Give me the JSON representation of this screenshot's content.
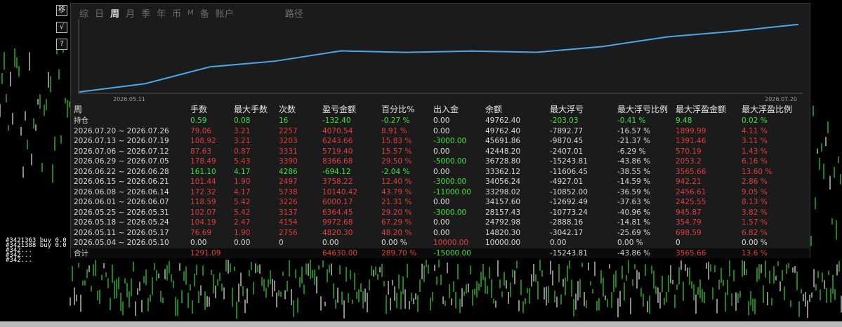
{
  "tabs": [
    "综",
    "日",
    "周",
    "月",
    "季",
    "年",
    "币",
    "M",
    "备",
    "账户",
    "路径"
  ],
  "active_tab": 2,
  "side_buttons": [
    "移",
    "√",
    "?"
  ],
  "chart": {
    "start_label": "2026.05.11",
    "end_label": "2026.07.20",
    "line_color": "#4aa8e8"
  },
  "columns": [
    "周",
    "手数",
    "最大手数",
    "次数",
    "盈亏金额",
    "百分比%",
    "出入金",
    "余额",
    "最大浮亏",
    "最大浮亏比例",
    "最大浮盈金额",
    "最大浮盈比例"
  ],
  "position_row": {
    "label": "持仓",
    "lots": "0.59",
    "max_lots": "0.08",
    "count": "16",
    "pnl": "-132.40",
    "pct": "-0.27 %",
    "flow": "0.00",
    "balance": "49762.40",
    "max_dd": "-203.03",
    "max_dd_pct": "-0.41 %",
    "max_fp": "9.48",
    "max_fp_pct": "0.02 %"
  },
  "rows": [
    {
      "week": "2026.07.20 ~ 2026.07.26",
      "lots": "79.06",
      "max_lots": "3.21",
      "count": "2257",
      "pnl": "4070.54",
      "pct": "8.91 %",
      "flow": "0.00",
      "balance": "49762.40",
      "max_dd": "-7892.77",
      "max_dd_pct": "-16.57 %",
      "max_fp": "1899.99",
      "max_fp_pct": "4.11 %"
    },
    {
      "week": "2026.07.13 ~ 2026.07.19",
      "lots": "108.92",
      "max_lots": "3.21",
      "count": "3203",
      "pnl": "6243.66",
      "pct": "15.83 %",
      "flow": "-3000.00",
      "balance": "45691.86",
      "max_dd": "-9870.45",
      "max_dd_pct": "-21.37 %",
      "max_fp": "1391.46",
      "max_fp_pct": "3.11 %"
    },
    {
      "week": "2026.07.06 ~ 2026.07.12",
      "lots": "87.63",
      "max_lots": "0.87",
      "count": "3331",
      "pnl": "5719.40",
      "pct": "15.57 %",
      "flow": "0.00",
      "balance": "42448.20",
      "max_dd": "-2407.01",
      "max_dd_pct": "-6.29 %",
      "max_fp": "570.19",
      "max_fp_pct": "1.43 %"
    },
    {
      "week": "2026.06.29 ~ 2026.07.05",
      "lots": "178.49",
      "max_lots": "5.43",
      "count": "3390",
      "pnl": "8366.68",
      "pct": "29.50 %",
      "flow": "-5000.00",
      "balance": "36728.80",
      "max_dd": "-15243.81",
      "max_dd_pct": "-43.86 %",
      "max_fp": "2053.2",
      "max_fp_pct": "6.16 %"
    },
    {
      "week": "2026.06.22 ~ 2026.06.28",
      "lots": "161.10",
      "max_lots": "4.17",
      "count": "4286",
      "pnl": "-694.12",
      "pct": "-2.04 %",
      "flow": "0.00",
      "balance": "33362.12",
      "max_dd": "-11606.45",
      "max_dd_pct": "-38.55 %",
      "max_fp": "3565.66",
      "max_fp_pct": "13.60 %",
      "loss": true
    },
    {
      "week": "2026.06.15 ~ 2026.06.21",
      "lots": "101.44",
      "max_lots": "1.90",
      "count": "2497",
      "pnl": "3758.22",
      "pct": "12.40 %",
      "flow": "-3000.00",
      "balance": "34056.24",
      "max_dd": "-4927.01",
      "max_dd_pct": "-14.59 %",
      "max_fp": "942.21",
      "max_fp_pct": "2.86 %"
    },
    {
      "week": "2026.06.08 ~ 2026.06.14",
      "lots": "172.32",
      "max_lots": "4.17",
      "count": "5738",
      "pnl": "10140.42",
      "pct": "43.79 %",
      "flow": "-11000.00",
      "balance": "33298.02",
      "max_dd": "-10852.00",
      "max_dd_pct": "-36.59 %",
      "max_fp": "2456.61",
      "max_fp_pct": "9.05 %"
    },
    {
      "week": "2026.06.01 ~ 2026.06.07",
      "lots": "118.59",
      "max_lots": "5.42",
      "count": "3226",
      "pnl": "6000.17",
      "pct": "21.31 %",
      "flow": "0.00",
      "balance": "34157.60",
      "max_dd": "-12692.49",
      "max_dd_pct": "-37.63 %",
      "max_fp": "2425.55",
      "max_fp_pct": "8.13 %"
    },
    {
      "week": "2026.05.25 ~ 2026.05.31",
      "lots": "102.07",
      "max_lots": "5.42",
      "count": "3137",
      "pnl": "6364.45",
      "pct": "29.20 %",
      "flow": "-3000.00",
      "balance": "28157.43",
      "max_dd": "-10773.24",
      "max_dd_pct": "-40.96 %",
      "max_fp": "945.87",
      "max_fp_pct": "3.82 %"
    },
    {
      "week": "2026.05.18 ~ 2026.05.24",
      "lots": "104.19",
      "max_lots": "2.47",
      "count": "4154",
      "pnl": "9972.68",
      "pct": "67.29 %",
      "flow": "0.00",
      "balance": "24792.98",
      "max_dd": "-2888.16",
      "max_dd_pct": "-14.81 %",
      "max_fp": "354.79",
      "max_fp_pct": "1.57 %"
    },
    {
      "week": "2026.05.11 ~ 2026.05.17",
      "lots": "76.69",
      "max_lots": "1.90",
      "count": "2756",
      "pnl": "4820.30",
      "pct": "48.20 %",
      "flow": "0.00",
      "balance": "14820.30",
      "max_dd": "-3042.17",
      "max_dd_pct": "-25.69 %",
      "max_fp": "698.59",
      "max_fp_pct": "6.82 %"
    },
    {
      "week": "2026.05.04 ~ 2026.05.10",
      "lots": "0.00",
      "max_lots": "0.00",
      "count": "0",
      "pnl": "0.00",
      "pct": "0.00 %",
      "flow": "10000.00",
      "balance": "10000.00",
      "max_dd": "0.00",
      "max_dd_pct": "0.00 %",
      "max_fp": "0",
      "max_fp_pct": "0.00 %",
      "zero": true
    }
  ],
  "total_row": {
    "label": "合计",
    "lots": "1291.09",
    "pnl": "64630.00",
    "pct": "289.70 %",
    "flow": "-15000.00",
    "max_dd": "-15243.81",
    "max_dd_pct": "-43.86 %",
    "max_fp": "3565.66",
    "max_fp_pct": "13.6 %"
  },
  "left_labels": [
    "#3421363 buy 0.0",
    "#3421388 buy 0.0",
    "#342...",
    "#342...",
    "#342..."
  ]
}
